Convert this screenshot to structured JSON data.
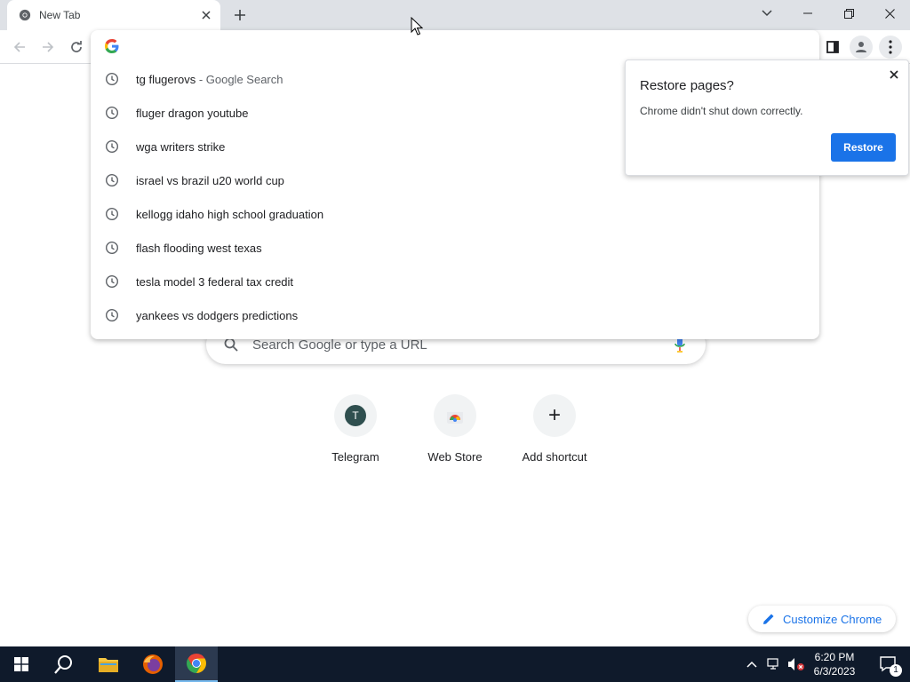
{
  "browser": {
    "tab_title": "New Tab",
    "omnibox_value": ""
  },
  "suggestions": [
    {
      "text": "tg flugerovs",
      "suffix": " - Google Search"
    },
    {
      "text": "fluger dragon youtube",
      "suffix": ""
    },
    {
      "text": "wga writers strike",
      "suffix": ""
    },
    {
      "text": "israel vs brazil u20 world cup",
      "suffix": ""
    },
    {
      "text": "kellogg idaho high school graduation",
      "suffix": ""
    },
    {
      "text": "flash flooding west texas",
      "suffix": ""
    },
    {
      "text": "tesla model 3 federal tax credit",
      "suffix": ""
    },
    {
      "text": "yankees vs dodgers predictions",
      "suffix": ""
    }
  ],
  "ntp": {
    "search_placeholder": "Search Google or type a URL",
    "shortcuts": [
      {
        "label": "Telegram",
        "initial": "T"
      },
      {
        "label": "Web Store"
      },
      {
        "label": "Add shortcut",
        "glyph": "+"
      }
    ],
    "customize_label": "Customize Chrome"
  },
  "restore_dialog": {
    "title": "Restore pages?",
    "message": "Chrome didn't shut down correctly.",
    "button_label": "Restore"
  },
  "taskbar": {
    "time": "6:20 PM",
    "date": "6/3/2023",
    "notification_count": "1"
  },
  "colors": {
    "accent": "#1a73e8",
    "tabstrip": "#dee1e6",
    "taskbar": "#0f1a2b",
    "telegram_avatar": "#2f4f4f"
  }
}
